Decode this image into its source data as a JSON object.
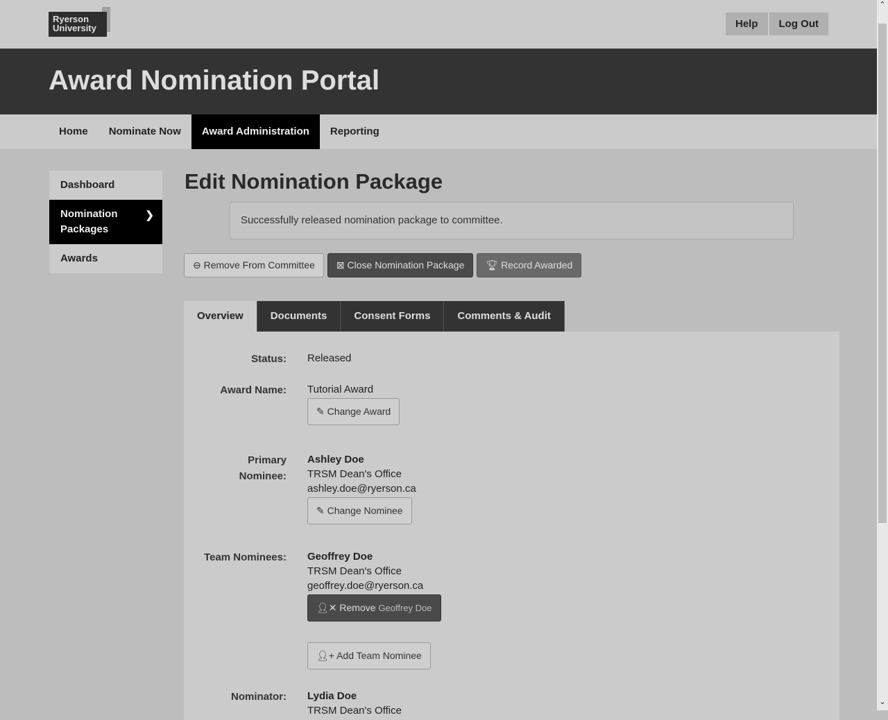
{
  "header": {
    "logo": "Ryerson University",
    "help": "Help",
    "logout": "Log Out",
    "title": "Award Nomination Portal"
  },
  "nav": [
    "Home",
    "Nominate Now",
    "Award Administration",
    "Reporting"
  ],
  "sidebar": [
    "Dashboard",
    "Nomination Packages",
    "Awards"
  ],
  "page_title": "Edit Nomination Package",
  "alert": "Successfully released nomination package to committee.",
  "actions": {
    "remove": "Remove From Committee",
    "close": "Close Nomination Package",
    "record": "Record Awarded"
  },
  "tabs": [
    "Overview",
    "Documents",
    "Consent Forms",
    "Comments & Audit"
  ],
  "overview": {
    "status_label": "Status:",
    "status": "Released",
    "award_label": "Award Name:",
    "award": "Tutorial Award",
    "change_award": "Change Award",
    "primary_label": "Primary Nominee:",
    "primary_name": "Ashley Doe",
    "primary_dept": "TRSM Dean's Office",
    "primary_email": "ashley.doe@ryerson.ca",
    "change_nominee": "Change Nominee",
    "team_label": "Team Nominees:",
    "team_name": "Geoffrey Doe",
    "team_dept": "TRSM Dean's Office",
    "team_email": "geoffrey.doe@ryerson.ca",
    "remove_label": "Remove",
    "remove_name": "Geoffrey Doe",
    "add_team": "Add Team Nominee",
    "nominator_label": "Nominator:",
    "nominator_name": "Lydia Doe",
    "nominator_dept": "TRSM Dean's Office"
  }
}
